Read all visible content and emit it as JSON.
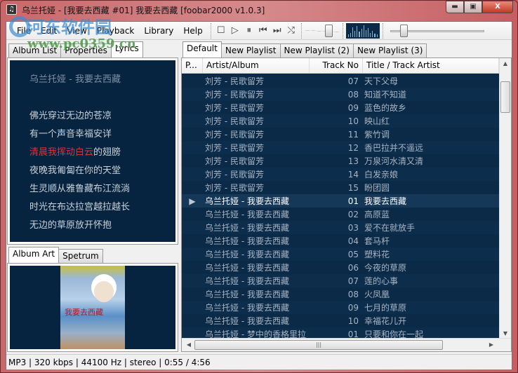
{
  "window": {
    "title": "乌兰托娅 - [我要去西藏 #01] 我要去西藏   [foobar2000 v1.0.3]",
    "buttons": {
      "minimize": "▬",
      "maximize": "▣",
      "close": "X"
    }
  },
  "menu": [
    "File",
    "Edit",
    "View",
    "Playback",
    "Library",
    "Help"
  ],
  "toolbar": {
    "buttons": [
      "stop",
      "play",
      "pause",
      "previous",
      "next",
      "random"
    ],
    "glyphs": [
      "☐",
      "▷",
      "⏸",
      "⏮",
      "⏭",
      "⤭"
    ],
    "volume_level": 0.75,
    "seek_position": 0.12
  },
  "left_tabs": [
    "Album List",
    "Properties",
    "Lyrics"
  ],
  "left_active_tab": "Lyrics",
  "lyrics": {
    "header": "乌兰托娅 - 我要去西藏",
    "lines": [
      "佛光穿过无边的苍凉",
      "有一个声音幸福安详",
      "",
      "夜晚我匍匐在你的天堂",
      "生灵顺从雅鲁藏布江流淌",
      "时光在布达拉宫越拉越长",
      "无边的草原放开怀抱"
    ],
    "current_sung": "清晨我挥动白云",
    "current_rest": "的翅膀",
    "highlight_color": "#e0303a"
  },
  "art_tabs": [
    "Album Art",
    "Spetrum"
  ],
  "art_caption": "我要去西藏",
  "playlist_tabs": [
    "Default",
    "New Playlist",
    "New Playlist (2)",
    "New Playlist (3)"
  ],
  "columns": [
    "P...",
    "Artist/Album",
    "Track No",
    "Title / Track Artist"
  ],
  "rows": [
    {
      "artist": "刘芳 - 民歌留芳",
      "no": "07",
      "title": "天下父母"
    },
    {
      "artist": "刘芳 - 民歌留芳",
      "no": "08",
      "title": "知道不知道"
    },
    {
      "artist": "刘芳 - 民歌留芳",
      "no": "09",
      "title": "蓝色的故乡"
    },
    {
      "artist": "刘芳 - 民歌留芳",
      "no": "10",
      "title": "映山红"
    },
    {
      "artist": "刘芳 - 民歌留芳",
      "no": "11",
      "title": "紫竹调"
    },
    {
      "artist": "刘芳 - 民歌留芳",
      "no": "12",
      "title": "香巴拉并不遥远"
    },
    {
      "artist": "刘芳 - 民歌留芳",
      "no": "13",
      "title": "万泉河水清又清"
    },
    {
      "artist": "刘芳 - 民歌留芳",
      "no": "14",
      "title": "白发亲娘"
    },
    {
      "artist": "刘芳 - 民歌留芳",
      "no": "15",
      "title": "盼团圆"
    },
    {
      "artist": "乌兰托娅 - 我要去西藏",
      "no": "01",
      "title": "我要去西藏",
      "playing": true,
      "indicator": "▶"
    },
    {
      "artist": "乌兰托娅 - 我要去西藏",
      "no": "02",
      "title": "高原蓝"
    },
    {
      "artist": "乌兰托娅 - 我要去西藏",
      "no": "03",
      "title": "爱不在就放手"
    },
    {
      "artist": "乌兰托娅 - 我要去西藏",
      "no": "04",
      "title": "套马杆"
    },
    {
      "artist": "乌兰托娅 - 我要去西藏",
      "no": "05",
      "title": "塑料花"
    },
    {
      "artist": "乌兰托娅 - 我要去西藏",
      "no": "06",
      "title": "今夜的草原"
    },
    {
      "artist": "乌兰托娅 - 我要去西藏",
      "no": "07",
      "title": "莲的心事"
    },
    {
      "artist": "乌兰托娅 - 我要去西藏",
      "no": "08",
      "title": "火凤凰"
    },
    {
      "artist": "乌兰托娅 - 我要去西藏",
      "no": "09",
      "title": "七月的草原"
    },
    {
      "artist": "乌兰托娅 - 我要去西藏",
      "no": "10",
      "title": "幸福花儿开"
    },
    {
      "artist": "乌兰托娅 - 梦中的香格里拉",
      "no": "01",
      "title": "只要和你在一起"
    }
  ],
  "status": "MP3 | 320 kbps | 44100 Hz | stereo | 0:55 / 4:56",
  "watermark": {
    "logo": "河东软件园",
    "url": "www.pc0359.cn"
  }
}
